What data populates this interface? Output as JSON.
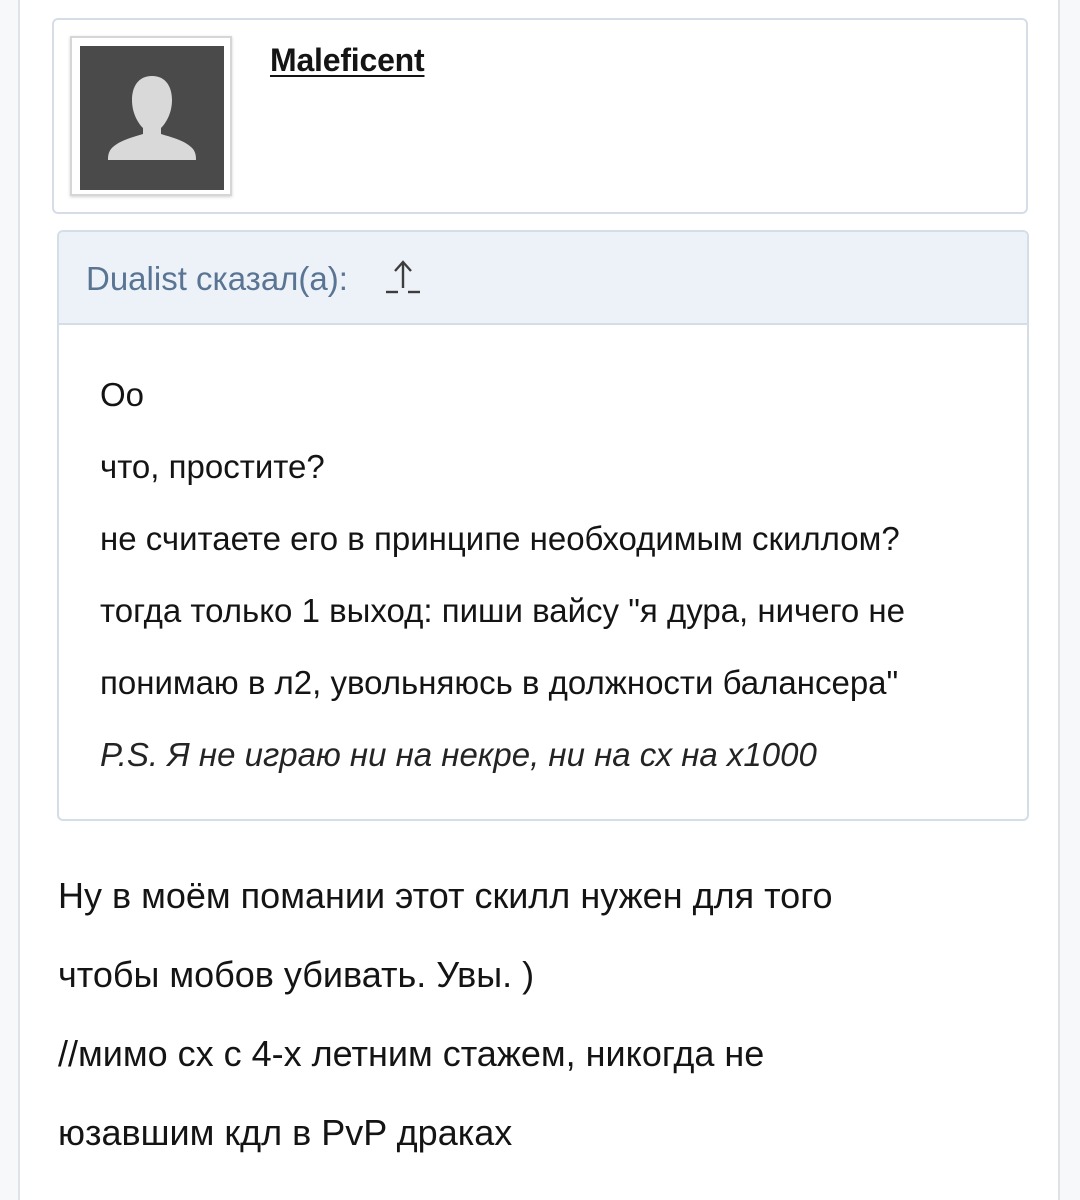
{
  "author": {
    "name": "Maleficent",
    "avatar_icon": "default-user-silhouette-icon"
  },
  "quote": {
    "author_label": "Dualist сказал(а):",
    "jump_icon": "arrow-up-icon",
    "lines": [
      "Оо",
      "что, простите?",
      "не считаете его в принципе необходимым скиллом?",
      "тогда только 1 выход: пиши вайсу \"я дура, ничего не",
      "понимаю в л2, увольняюсь в должности балансера\""
    ],
    "ps_line": "P.S. Я не играю ни на некре, ни на сх на х1000"
  },
  "reply": {
    "lines": [
      "Ну в моём помании этот скилл нужен для того",
      "чтобы мобов убивать. Увы. )",
      "//мимо сх с 4-х летним стажем, никогда не",
      "юзавшим кдл в PvP драках"
    ]
  },
  "colors": {
    "quote_header_bg": "#edf2f8",
    "quote_author_text": "#5a7594",
    "card_border": "#d6dde6",
    "avatar_bg": "#4a4a4a",
    "avatar_silhouette": "#d9d9d9"
  }
}
